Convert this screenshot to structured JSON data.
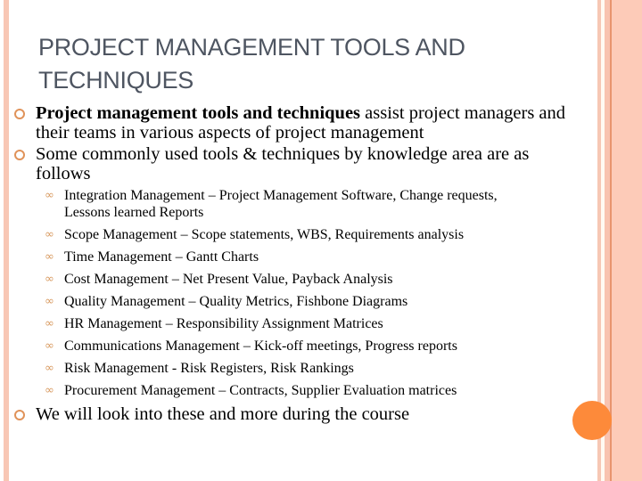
{
  "slide": {
    "title_line1": "PROJECT MANAGEMENT TOOLS AND",
    "title_line2": "TECHNIQUES",
    "bullets": [
      {
        "bold": "Project management tools and techniques",
        "text": " assist project managers and",
        "cont": "their teams in various aspects of project management"
      },
      {
        "text": "Some commonly used tools & techniques by knowledge area are as",
        "cont": "follows"
      }
    ],
    "sub_bullets": [
      {
        "text": "Integration Management – Project Management Software, Change requests,",
        "cont": "Lessons learned Reports"
      },
      {
        "text": "Scope Management – Scope statements, WBS, Requirements analysis"
      },
      {
        "text": "Time Management – Gantt Charts"
      },
      {
        "text": "Cost Management – Net Present Value, Payback Analysis"
      },
      {
        "text": "Quality Management – Quality Metrics, Fishbone Diagrams"
      },
      {
        "text": "HR Management – Responsibility Assignment Matrices"
      },
      {
        "text": "Communications Management – Kick-off meetings, Progress reports"
      },
      {
        "text": "Risk Management -  Risk Registers, Risk Rankings"
      },
      {
        "text": "Procurement Management – Contracts, Supplier Evaluation matrices"
      }
    ],
    "last_bullet": "We will look into these and more during the course",
    "icons": {
      "main_bullet": "hollow-circle-icon",
      "sub_bullet": "curl-icon",
      "sub_bullet_glyph": "∞"
    },
    "colors": {
      "accent": "#fd8a3a",
      "stripe": "#f8c7b5",
      "title": "#4e5561"
    }
  }
}
